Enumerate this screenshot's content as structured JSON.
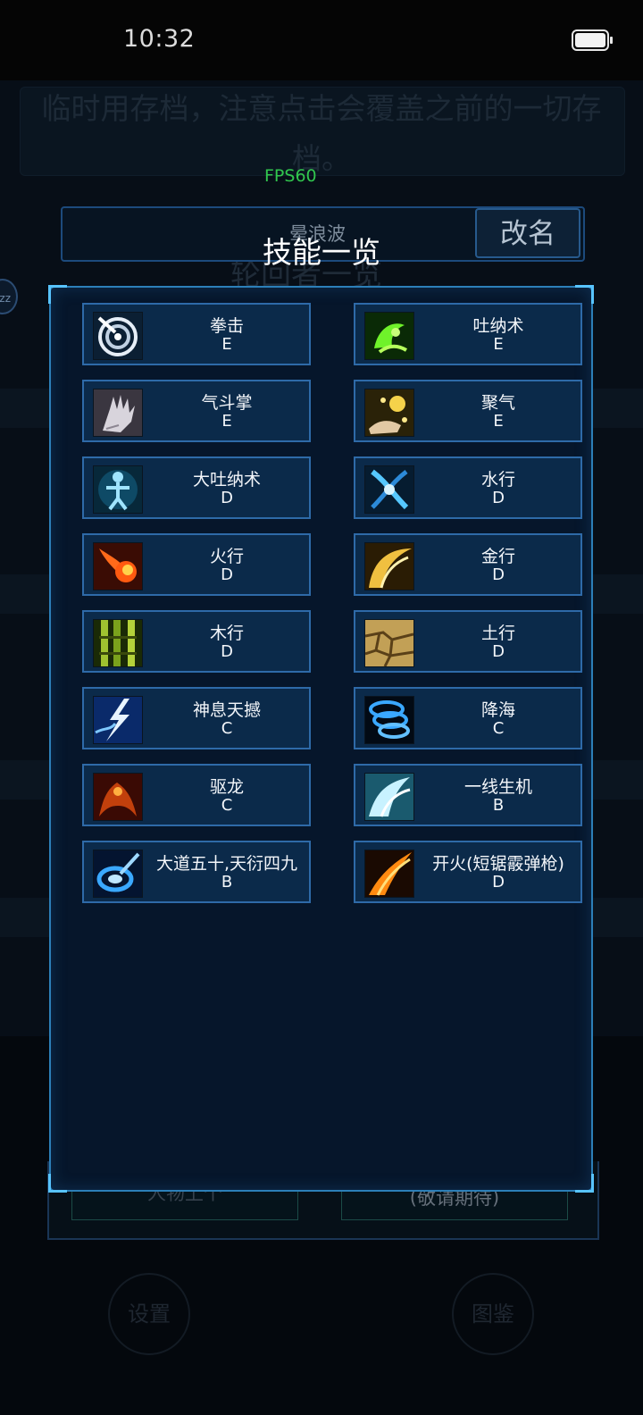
{
  "status_bar": {
    "time": "10:32",
    "battery_icon": "battery-full-icon"
  },
  "background": {
    "notice": "临时用存档，注意点击会覆盖之前的一切存档。",
    "fps": "FPS60",
    "title": "轮回者一览",
    "left_badge": "zz",
    "button_left": "人物上个",
    "button_right": "(敬请期待)",
    "round_button_left": "设置",
    "round_button_right": "图鉴"
  },
  "rename": {
    "name": "晕浪波",
    "button_label": "改名"
  },
  "dialog": {
    "title": "技能一览",
    "skills": [
      {
        "name": "拳击",
        "grade": "E",
        "icon": "target-spiral-icon"
      },
      {
        "name": "吐纳术",
        "grade": "E",
        "icon": "green-breath-icon"
      },
      {
        "name": "气斗掌",
        "grade": "E",
        "icon": "palm-hand-icon"
      },
      {
        "name": "聚气",
        "grade": "E",
        "icon": "gather-qi-hand-icon"
      },
      {
        "name": "大吐纳术",
        "grade": "D",
        "icon": "meditating-figure-icon"
      },
      {
        "name": "水行",
        "grade": "D",
        "icon": "water-vortex-icon"
      },
      {
        "name": "火行",
        "grade": "D",
        "icon": "fireball-icon"
      },
      {
        "name": "金行",
        "grade": "D",
        "icon": "golden-arc-icon"
      },
      {
        "name": "木行",
        "grade": "D",
        "icon": "bamboo-icon"
      },
      {
        "name": "土行",
        "grade": "D",
        "icon": "cracked-earth-icon"
      },
      {
        "name": "神息天撼",
        "grade": "C",
        "icon": "lightning-icon"
      },
      {
        "name": "降海",
        "grade": "C",
        "icon": "water-rings-icon"
      },
      {
        "name": "驱龙",
        "grade": "C",
        "icon": "red-dragon-icon"
      },
      {
        "name": "一线生机",
        "grade": "B",
        "icon": "ice-wing-icon"
      },
      {
        "name": "大道五十,天衍四九",
        "grade": "B",
        "icon": "blue-vortex-icon"
      },
      {
        "name": "开火(短锯霰弹枪)",
        "grade": "D",
        "icon": "fire-slash-icon"
      }
    ]
  }
}
